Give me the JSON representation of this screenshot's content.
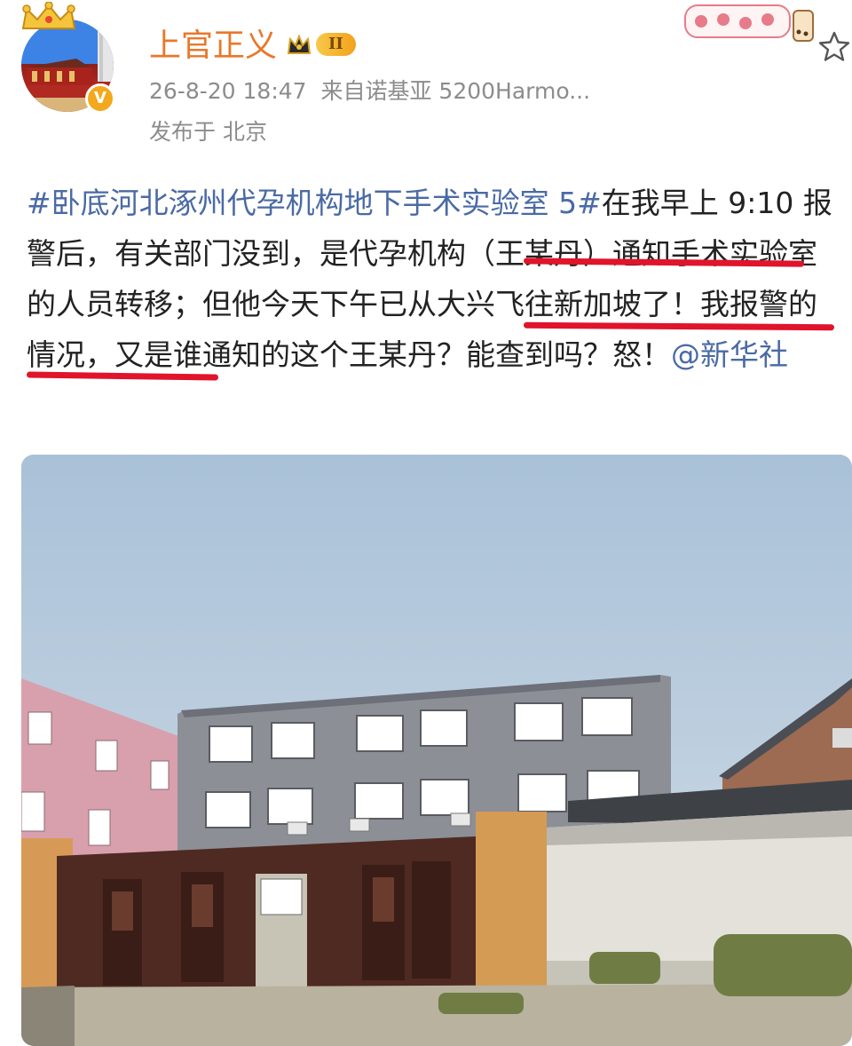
{
  "post": {
    "author": "上官正义",
    "level_badge": "II",
    "timestamp": "26-8-20 18:47",
    "source": "来自诺基亚 5200Harmo...",
    "location": "发布于 北京",
    "hashtag": "#卧底河北涿州代孕机构地下手术实验室 5#",
    "text_1": "在我早上 9:10 报警后，有关部门没到，是",
    "hl_1": "代孕机构（王某丹）",
    "text_2": "通知手术实验室的人员转移；但",
    "hl_2": "他今天下午已从大兴飞往新加坡了",
    "text_3": "！我报警的情况，又是谁通知的这个王某丹？能查到吗？怒！",
    "mention": "@新华社"
  },
  "icons": {
    "verified": "verified-badge-icon",
    "star": "star-outline-icon",
    "crown": "crown-icon",
    "sticker": "milk-tea-sticker"
  },
  "colors": {
    "username": "#e8782a",
    "link": "#4a6aa5",
    "underline": "#e0142a",
    "meta": "#8c8c8c"
  }
}
